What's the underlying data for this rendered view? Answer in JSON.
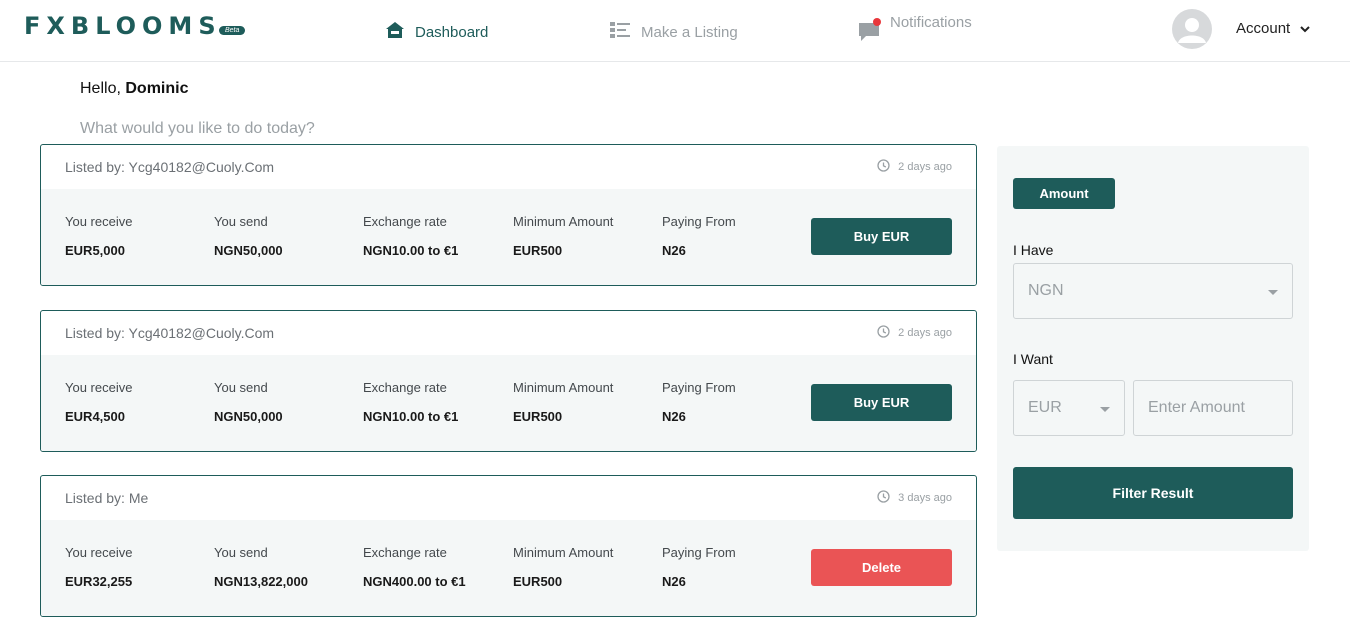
{
  "header": {
    "logo": "FXBLOOMS",
    "beta": "Beta",
    "nav": {
      "dashboard": "Dashboard",
      "make_listing": "Make a Listing",
      "notifications": "Notifications"
    },
    "account": "Account"
  },
  "greeting": {
    "hello": "Hello, ",
    "name": "Dominic",
    "subtitle": "What would you like to do today?"
  },
  "columns": {
    "receive": "You receive",
    "send": "You send",
    "rate": "Exchange rate",
    "minimum": "Minimum Amount",
    "paying": "Paying From"
  },
  "listings": [
    {
      "listed_by": "Listed by: Ycg40182@Cuoly.Com",
      "time": "2 days ago",
      "receive": "EUR5,000",
      "send": "NGN50,000",
      "rate": "NGN10.00 to €1",
      "minimum": "EUR500",
      "paying": "N26",
      "action": "Buy EUR"
    },
    {
      "listed_by": "Listed by: Ycg40182@Cuoly.Com",
      "time": "2 days ago",
      "receive": "EUR4,500",
      "send": "NGN50,000",
      "rate": "NGN10.00 to €1",
      "minimum": "EUR500",
      "paying": "N26",
      "action": "Buy EUR"
    },
    {
      "listed_by": "Listed by: Me",
      "time": "3 days ago",
      "receive": "EUR32,255",
      "send": "NGN13,822,000",
      "rate": "NGN400.00 to €1",
      "minimum": "EUR500",
      "paying": "N26",
      "action": "Delete"
    }
  ],
  "filter": {
    "tab": "Amount",
    "have_label": "I Have",
    "have_value": "NGN",
    "want_label": "I Want",
    "want_currency": "EUR",
    "amount_placeholder": "Enter Amount",
    "submit": "Filter Result"
  },
  "colors": {
    "primary": "#1e5c5a",
    "danger": "#ea5455",
    "notification_dot": "#e8373b"
  }
}
